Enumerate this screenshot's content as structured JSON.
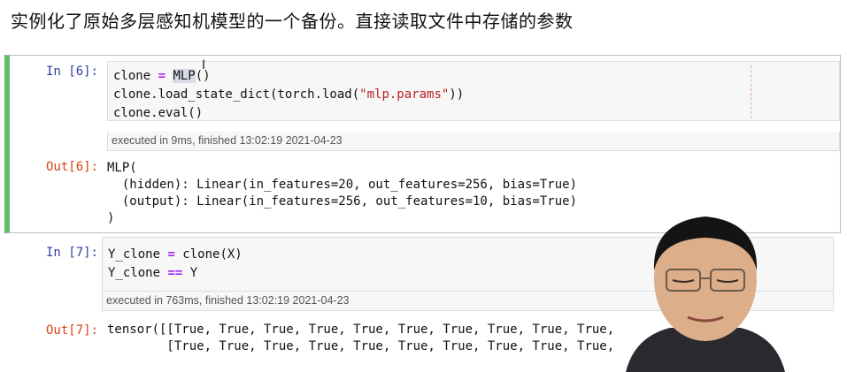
{
  "heading": "实例化了原始多层感知机模型的一个备份。直接读取文件中存储的参数",
  "cells": [
    {
      "in_prompt": "In [6]:",
      "code": {
        "l1_a": "clone ",
        "l1_op": "=",
        "l1_sp": " ",
        "l1_hl": "MLP",
        "l1_b": "()",
        "l2_a": "clone.load_state_dict(torch.load(",
        "l2_str": "\"mlp.params\"",
        "l2_b": "))",
        "l3": "clone.eval()"
      },
      "exec": "executed in 9ms, finished 13:02:19 2021-04-23",
      "out_prompt": "Out[6]:",
      "output": "MLP(\n  (hidden): Linear(in_features=20, out_features=256, bias=True)\n  (output): Linear(in_features=256, out_features=10, bias=True)\n)"
    },
    {
      "in_prompt": "In [7]:",
      "code": {
        "l1_a": "Y_clone ",
        "l1_op": "=",
        "l1_b": " clone(X)",
        "l2_a": "Y_clone ",
        "l2_op": "==",
        "l2_b": " Y"
      },
      "exec": "executed in 763ms, finished 13:02:19 2021-04-23",
      "out_prompt": "Out[7]:",
      "output": "tensor([[True, True, True, True, True, True, True, True, True, True,\n        [True, True, True, True, True, True, True, True, True, True,"
    }
  ],
  "colors": {
    "selected_border": "#66bb6a",
    "in_prompt": "#303f9f",
    "out_prompt": "#d84315",
    "keyword": "#aa22ff",
    "string": "#ba2121"
  }
}
